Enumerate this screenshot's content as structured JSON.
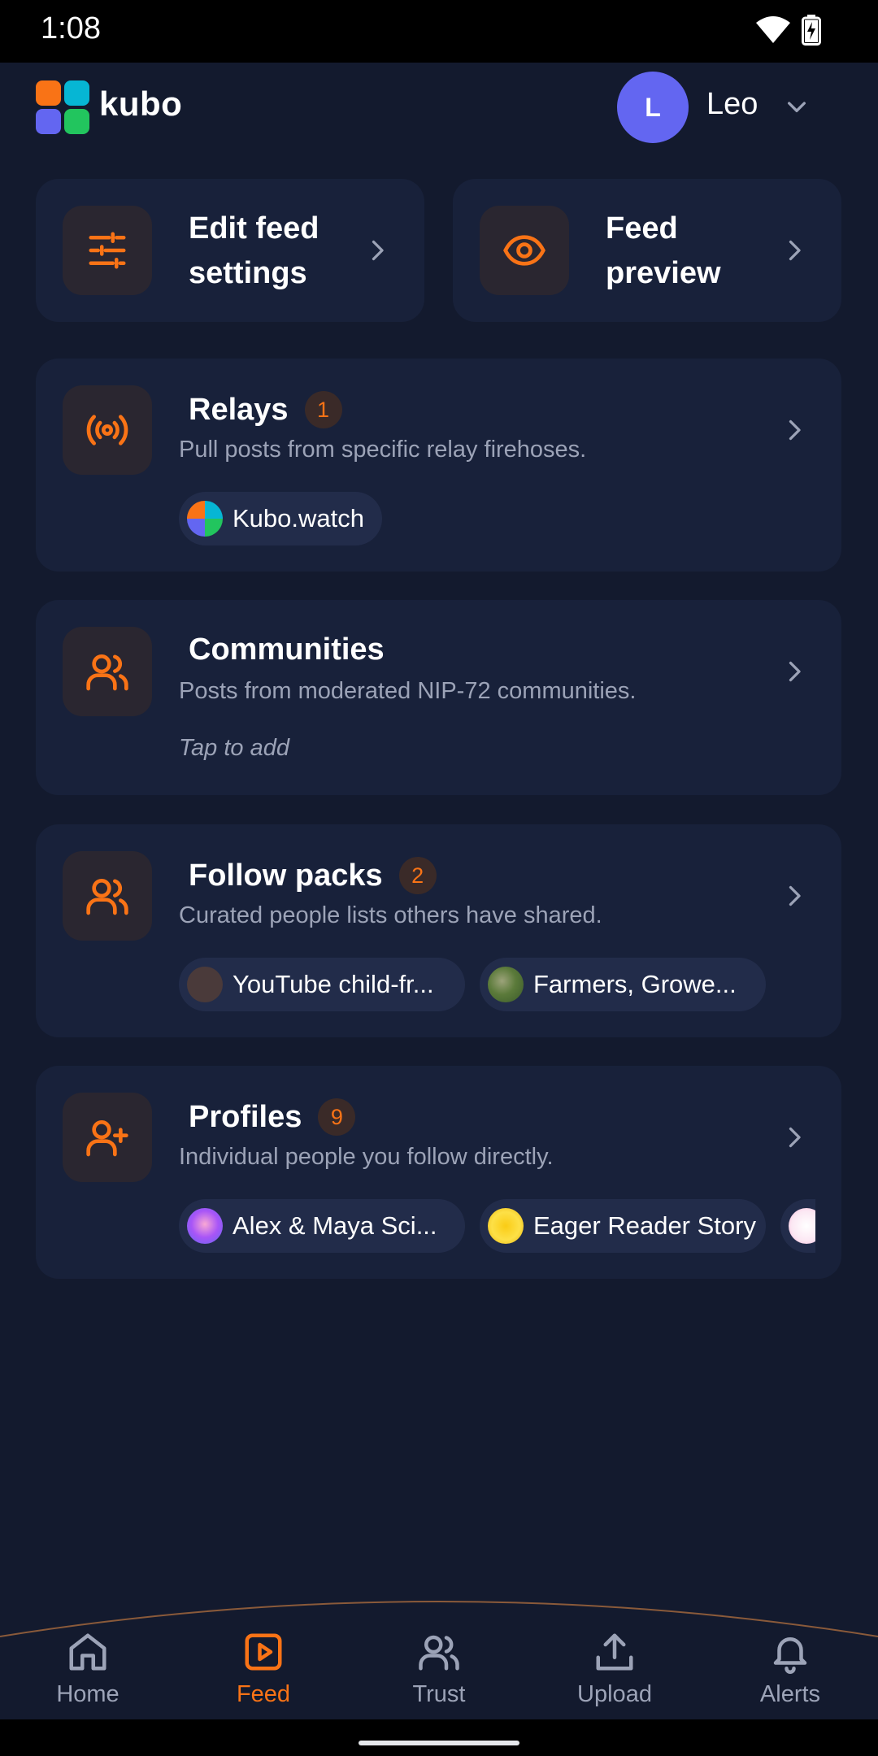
{
  "status": {
    "time": "1:08"
  },
  "header": {
    "app_name": "kubo",
    "user_initial": "L",
    "user_name": "Leo"
  },
  "quick_actions": {
    "edit_feed_line1": "Edit feed",
    "edit_feed_line2": "settings",
    "preview_line1": "Feed",
    "preview_line2": "preview"
  },
  "sections": {
    "relays": {
      "title": "Relays",
      "badge": "1",
      "subtitle": "Pull posts from specific relay firehoses.",
      "chips": [
        "Kubo.watch"
      ]
    },
    "communities": {
      "title": "Communities",
      "subtitle": "Posts from moderated NIP-72 communities.",
      "empty_hint": "Tap to add"
    },
    "follow_packs": {
      "title": "Follow packs",
      "badge": "2",
      "subtitle": "Curated people lists others have shared.",
      "chips": [
        "YouTube child-fr...",
        "Farmers, Growe..."
      ]
    },
    "profiles": {
      "title": "Profiles",
      "badge": "9",
      "subtitle": "Individual people you follow directly.",
      "chips": [
        "Alex & Maya Sci...",
        "Eager Reader Story"
      ]
    }
  },
  "nav": {
    "items": [
      {
        "label": "Home",
        "icon": "home-icon"
      },
      {
        "label": "Feed",
        "icon": "play-square-icon",
        "active": true
      },
      {
        "label": "Trust",
        "icon": "users-icon"
      },
      {
        "label": "Upload",
        "icon": "upload-icon"
      },
      {
        "label": "Alerts",
        "icon": "bell-icon"
      }
    ]
  },
  "colors": {
    "background": "#131a2e",
    "card": "#18213a",
    "accent": "#f97316",
    "avatar": "#6366f1",
    "muted_text": "#9ca3b7"
  }
}
